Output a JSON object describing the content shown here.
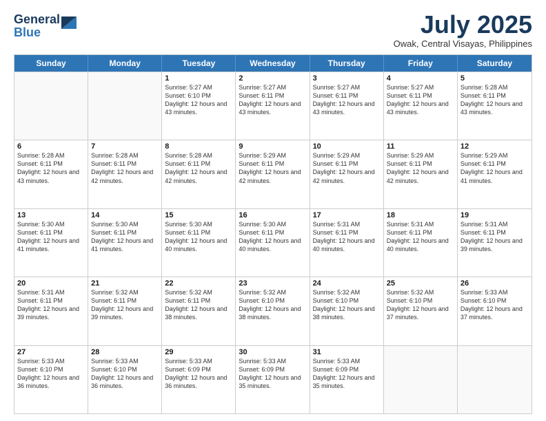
{
  "logo": {
    "line1": "General",
    "line2": "Blue"
  },
  "title": "July 2025",
  "location": "Owak, Central Visayas, Philippines",
  "days": [
    "Sunday",
    "Monday",
    "Tuesday",
    "Wednesday",
    "Thursday",
    "Friday",
    "Saturday"
  ],
  "weeks": [
    [
      {
        "day": "",
        "text": ""
      },
      {
        "day": "",
        "text": ""
      },
      {
        "day": "1",
        "text": "Sunrise: 5:27 AM\nSunset: 6:10 PM\nDaylight: 12 hours and 43 minutes."
      },
      {
        "day": "2",
        "text": "Sunrise: 5:27 AM\nSunset: 6:11 PM\nDaylight: 12 hours and 43 minutes."
      },
      {
        "day": "3",
        "text": "Sunrise: 5:27 AM\nSunset: 6:11 PM\nDaylight: 12 hours and 43 minutes."
      },
      {
        "day": "4",
        "text": "Sunrise: 5:27 AM\nSunset: 6:11 PM\nDaylight: 12 hours and 43 minutes."
      },
      {
        "day": "5",
        "text": "Sunrise: 5:28 AM\nSunset: 6:11 PM\nDaylight: 12 hours and 43 minutes."
      }
    ],
    [
      {
        "day": "6",
        "text": "Sunrise: 5:28 AM\nSunset: 6:11 PM\nDaylight: 12 hours and 43 minutes."
      },
      {
        "day": "7",
        "text": "Sunrise: 5:28 AM\nSunset: 6:11 PM\nDaylight: 12 hours and 42 minutes."
      },
      {
        "day": "8",
        "text": "Sunrise: 5:28 AM\nSunset: 6:11 PM\nDaylight: 12 hours and 42 minutes."
      },
      {
        "day": "9",
        "text": "Sunrise: 5:29 AM\nSunset: 6:11 PM\nDaylight: 12 hours and 42 minutes."
      },
      {
        "day": "10",
        "text": "Sunrise: 5:29 AM\nSunset: 6:11 PM\nDaylight: 12 hours and 42 minutes."
      },
      {
        "day": "11",
        "text": "Sunrise: 5:29 AM\nSunset: 6:11 PM\nDaylight: 12 hours and 42 minutes."
      },
      {
        "day": "12",
        "text": "Sunrise: 5:29 AM\nSunset: 6:11 PM\nDaylight: 12 hours and 41 minutes."
      }
    ],
    [
      {
        "day": "13",
        "text": "Sunrise: 5:30 AM\nSunset: 6:11 PM\nDaylight: 12 hours and 41 minutes."
      },
      {
        "day": "14",
        "text": "Sunrise: 5:30 AM\nSunset: 6:11 PM\nDaylight: 12 hours and 41 minutes."
      },
      {
        "day": "15",
        "text": "Sunrise: 5:30 AM\nSunset: 6:11 PM\nDaylight: 12 hours and 40 minutes."
      },
      {
        "day": "16",
        "text": "Sunrise: 5:30 AM\nSunset: 6:11 PM\nDaylight: 12 hours and 40 minutes."
      },
      {
        "day": "17",
        "text": "Sunrise: 5:31 AM\nSunset: 6:11 PM\nDaylight: 12 hours and 40 minutes."
      },
      {
        "day": "18",
        "text": "Sunrise: 5:31 AM\nSunset: 6:11 PM\nDaylight: 12 hours and 40 minutes."
      },
      {
        "day": "19",
        "text": "Sunrise: 5:31 AM\nSunset: 6:11 PM\nDaylight: 12 hours and 39 minutes."
      }
    ],
    [
      {
        "day": "20",
        "text": "Sunrise: 5:31 AM\nSunset: 6:11 PM\nDaylight: 12 hours and 39 minutes."
      },
      {
        "day": "21",
        "text": "Sunrise: 5:32 AM\nSunset: 6:11 PM\nDaylight: 12 hours and 39 minutes."
      },
      {
        "day": "22",
        "text": "Sunrise: 5:32 AM\nSunset: 6:11 PM\nDaylight: 12 hours and 38 minutes."
      },
      {
        "day": "23",
        "text": "Sunrise: 5:32 AM\nSunset: 6:10 PM\nDaylight: 12 hours and 38 minutes."
      },
      {
        "day": "24",
        "text": "Sunrise: 5:32 AM\nSunset: 6:10 PM\nDaylight: 12 hours and 38 minutes."
      },
      {
        "day": "25",
        "text": "Sunrise: 5:32 AM\nSunset: 6:10 PM\nDaylight: 12 hours and 37 minutes."
      },
      {
        "day": "26",
        "text": "Sunrise: 5:33 AM\nSunset: 6:10 PM\nDaylight: 12 hours and 37 minutes."
      }
    ],
    [
      {
        "day": "27",
        "text": "Sunrise: 5:33 AM\nSunset: 6:10 PM\nDaylight: 12 hours and 36 minutes."
      },
      {
        "day": "28",
        "text": "Sunrise: 5:33 AM\nSunset: 6:10 PM\nDaylight: 12 hours and 36 minutes."
      },
      {
        "day": "29",
        "text": "Sunrise: 5:33 AM\nSunset: 6:09 PM\nDaylight: 12 hours and 36 minutes."
      },
      {
        "day": "30",
        "text": "Sunrise: 5:33 AM\nSunset: 6:09 PM\nDaylight: 12 hours and 35 minutes."
      },
      {
        "day": "31",
        "text": "Sunrise: 5:33 AM\nSunset: 6:09 PM\nDaylight: 12 hours and 35 minutes."
      },
      {
        "day": "",
        "text": ""
      },
      {
        "day": "",
        "text": ""
      }
    ]
  ]
}
